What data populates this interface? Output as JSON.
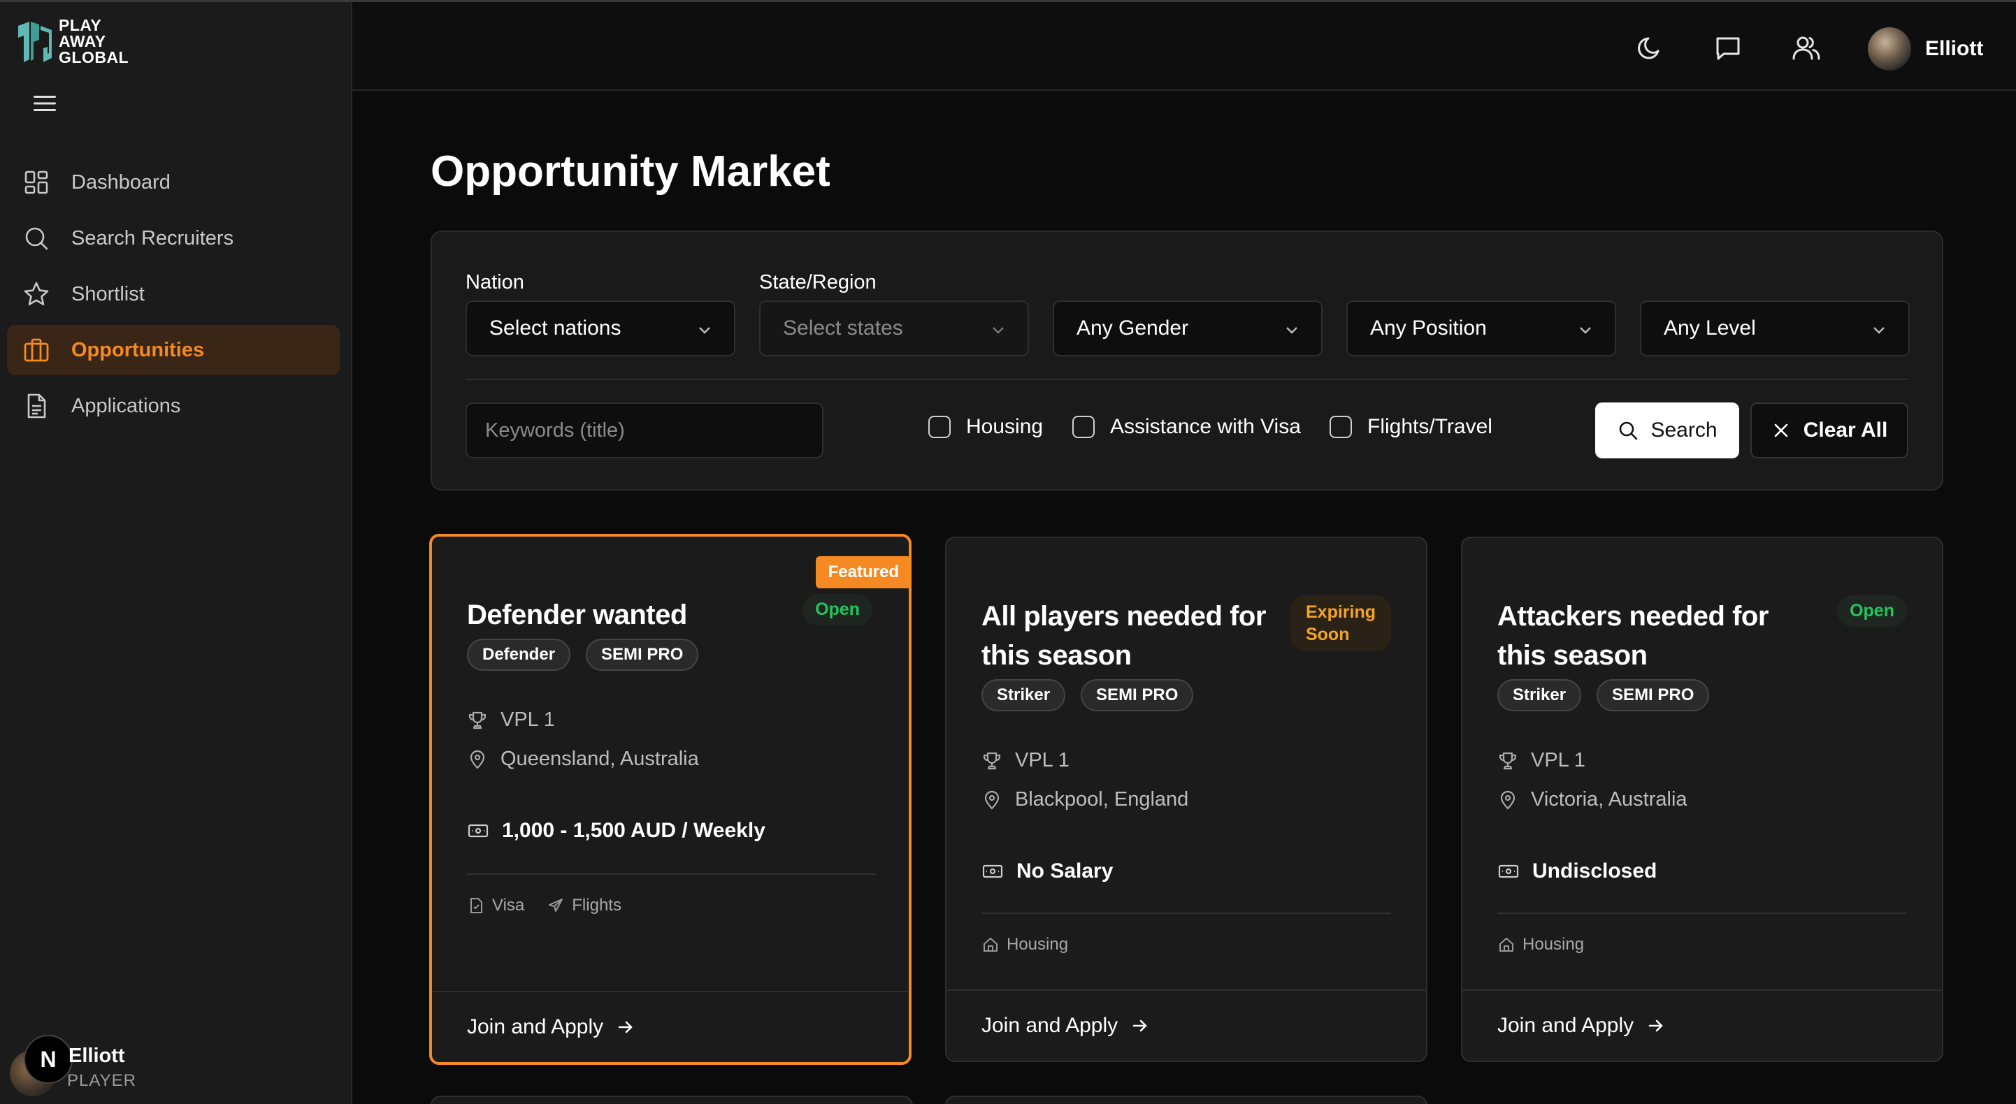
{
  "brand": {
    "line1": "PLAY",
    "line2": "AWAY",
    "line3": "GLOBAL"
  },
  "sidebar": {
    "items": [
      {
        "label": "Dashboard",
        "icon": "grid-icon",
        "active": false
      },
      {
        "label": "Search Recruiters",
        "icon": "search-icon",
        "active": false
      },
      {
        "label": "Shortlist",
        "icon": "star-icon",
        "active": false
      },
      {
        "label": "Opportunities",
        "icon": "briefcase-icon",
        "active": true
      },
      {
        "label": "Applications",
        "icon": "document-icon",
        "active": false
      }
    ],
    "user": {
      "name": "Elliott",
      "role": "PLAYER",
      "badge": "N"
    }
  },
  "topbar": {
    "username": "Elliott"
  },
  "page": {
    "title": "Opportunity Market"
  },
  "filters": {
    "nation_label": "Nation",
    "nation_value": "Select nations",
    "state_label": "State/Region",
    "state_value": "Select states",
    "gender_value": "Any Gender",
    "position_value": "Any Position",
    "level_value": "Any Level",
    "keyword_placeholder": "Keywords (title)",
    "housing": "Housing",
    "visa": "Assistance with Visa",
    "flights": "Flights/Travel",
    "search_label": "Search",
    "clear_label": "Clear All"
  },
  "cards": [
    {
      "featured_label": "Featured",
      "title": "Defender wanted",
      "status": "Open",
      "chips": [
        "Defender",
        "SEMI PRO"
      ],
      "league": "VPL 1",
      "location": "Queensland, Australia",
      "salary": "1,000 - 1,500 AUD / Weekly",
      "perks": [
        "Visa",
        "Flights"
      ],
      "cta": "Join and Apply"
    },
    {
      "title": "All players needed for this season",
      "status_line1": "Expiring",
      "status_line2": "Soon",
      "chips": [
        "Striker",
        "SEMI PRO"
      ],
      "league": "VPL 1",
      "location": "Blackpool, England",
      "salary": "No Salary",
      "perks": [
        "Housing"
      ],
      "cta": "Join and Apply"
    },
    {
      "title": "Attackers needed for this season",
      "status": "Open",
      "chips": [
        "Striker",
        "SEMI PRO"
      ],
      "league": "VPL 1",
      "location": "Victoria, Australia",
      "salary": "Undisclosed",
      "perks": [
        "Housing"
      ],
      "cta": "Join and Apply"
    }
  ],
  "colors": {
    "accent": "#f58a22",
    "open": "#22c55e",
    "expiring": "#f5a524",
    "background": "#0b0b0b",
    "panel": "#1b1b1b"
  }
}
